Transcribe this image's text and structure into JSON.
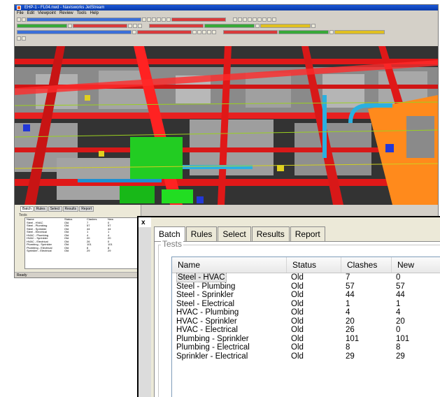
{
  "app": {
    "title": "EHP-1 - FL04.nwd - Navisworks JetStream",
    "menu": [
      "File",
      "Edit",
      "Viewpoint",
      "Review",
      "Tools",
      "Help"
    ],
    "status": "Ready"
  },
  "mini_panel": {
    "tabs": [
      "Batch",
      "Rules",
      "Select",
      "Results",
      "Report"
    ],
    "group": "Tests"
  },
  "panel": {
    "close": "x",
    "tabs": [
      {
        "label": "Batch",
        "active": true
      },
      {
        "label": "Rules"
      },
      {
        "label": "Select"
      },
      {
        "label": "Results"
      },
      {
        "label": "Report"
      }
    ],
    "group_label": "Tests",
    "columns": [
      "Name",
      "Status",
      "Clashes",
      "New"
    ],
    "rows": [
      {
        "name": "Steel - HVAC",
        "status": "Old",
        "clashes": "7",
        "new": "0"
      },
      {
        "name": "Steel - Plumbing",
        "status": "Old",
        "clashes": "57",
        "new": "57"
      },
      {
        "name": "Steel - Sprinkler",
        "status": "Old",
        "clashes": "44",
        "new": "44"
      },
      {
        "name": "Steel - Electrical",
        "status": "Old",
        "clashes": "1",
        "new": "1"
      },
      {
        "name": "HVAC - Plumbing",
        "status": "Old",
        "clashes": "4",
        "new": "4"
      },
      {
        "name": "HVAC - Sprinkler",
        "status": "Old",
        "clashes": "20",
        "new": "20"
      },
      {
        "name": "HVAC - Electrical",
        "status": "Old",
        "clashes": "26",
        "new": "0"
      },
      {
        "name": "Plumbing - Sprinkler",
        "status": "Old",
        "clashes": "101",
        "new": "101"
      },
      {
        "name": "Plumbing - Electrical",
        "status": "Old",
        "clashes": "8",
        "new": "8"
      },
      {
        "name": "Sprinkler - Electrical",
        "status": "Old",
        "clashes": "29",
        "new": "29"
      }
    ]
  },
  "colors": {
    "steel": "#e01818",
    "duct": "#9a9a9a",
    "pipe": "#2ab0e0",
    "equipment": "#22cc22",
    "highlight": "#ff8a1c"
  }
}
